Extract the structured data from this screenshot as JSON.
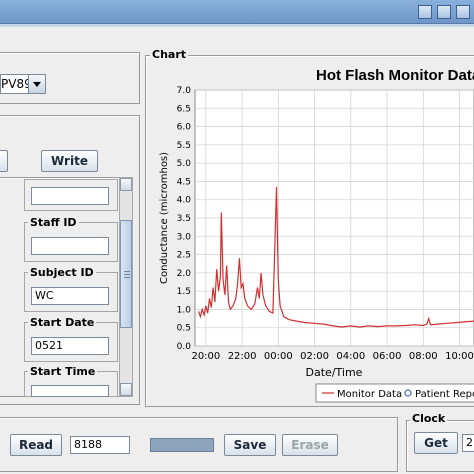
{
  "window": {},
  "chart_panel": {
    "title": "Chart"
  },
  "device": {
    "selected": "PV89"
  },
  "buttons": {
    "write": "Write",
    "read": "Read",
    "save": "Save",
    "erase": "Erase",
    "get": "Get"
  },
  "fields": {
    "staff_id": {
      "label": "Staff ID",
      "value": ""
    },
    "subject_id": {
      "label": "Subject ID",
      "value": "WC"
    },
    "start_date": {
      "label": "Start Date",
      "value": "0521"
    },
    "start_time": {
      "label": "Start Time",
      "value": ""
    },
    "top_field": {
      "value": ""
    }
  },
  "read_value": "8188",
  "clock": {
    "title": "Clock",
    "value": "2"
  },
  "colors": {
    "series": "#d03030",
    "legend_circle": "#4a6ab0",
    "accent": "#6e97c8"
  },
  "chart_data": {
    "type": "line",
    "title": "Hot Flash Monitor Data",
    "xlabel": "Date/Time",
    "ylabel": "Conductance (micromhos)",
    "x_tick_labels": [
      "20:00",
      "22:00",
      "00:00",
      "02:00",
      "04:00",
      "06:00",
      "08:00",
      "10:00"
    ],
    "x_range_hours": [
      19.4,
      34.8
    ],
    "y_ticks": [
      "0.0",
      "0.5",
      "1.0",
      "1.5",
      "2.0",
      "2.5",
      "3.0",
      "3.5",
      "4.0",
      "4.5",
      "5.0",
      "5.5",
      "6.0",
      "6.5",
      "7.0"
    ],
    "ylim": [
      0,
      7
    ],
    "grid": true,
    "legend_position": "bottom",
    "series": [
      {
        "name": "Monitor Data",
        "style": "line",
        "color": "#d03030",
        "points": [
          [
            19.6,
            0.95
          ],
          [
            19.7,
            0.8
          ],
          [
            19.8,
            1.0
          ],
          [
            19.9,
            0.85
          ],
          [
            20.0,
            1.1
          ],
          [
            20.1,
            0.9
          ],
          [
            20.2,
            1.3
          ],
          [
            20.3,
            1.05
          ],
          [
            20.4,
            1.6
          ],
          [
            20.5,
            1.2
          ],
          [
            20.6,
            2.1
          ],
          [
            20.7,
            1.5
          ],
          [
            20.8,
            1.9
          ],
          [
            20.85,
            3.65
          ],
          [
            20.95,
            1.8
          ],
          [
            21.05,
            1.4
          ],
          [
            21.15,
            2.2
          ],
          [
            21.25,
            1.2
          ],
          [
            21.35,
            1.0
          ],
          [
            21.5,
            1.1
          ],
          [
            21.65,
            1.3
          ],
          [
            21.75,
            1.7
          ],
          [
            21.85,
            2.4
          ],
          [
            21.95,
            1.6
          ],
          [
            22.05,
            1.7
          ],
          [
            22.15,
            1.3
          ],
          [
            22.3,
            1.1
          ],
          [
            22.5,
            1.0
          ],
          [
            22.7,
            1.15
          ],
          [
            22.85,
            1.6
          ],
          [
            22.95,
            1.3
          ],
          [
            23.05,
            2.0
          ],
          [
            23.15,
            1.4
          ],
          [
            23.3,
            1.1
          ],
          [
            23.5,
            0.95
          ],
          [
            23.7,
            0.9
          ],
          [
            23.8,
            2.6
          ],
          [
            23.9,
            4.35
          ],
          [
            24.0,
            1.8
          ],
          [
            24.1,
            1.1
          ],
          [
            24.3,
            0.8
          ],
          [
            24.6,
            0.72
          ],
          [
            25.0,
            0.68
          ],
          [
            25.5,
            0.64
          ],
          [
            26.0,
            0.62
          ],
          [
            26.5,
            0.6
          ],
          [
            27.0,
            0.55
          ],
          [
            27.5,
            0.52
          ],
          [
            28.0,
            0.55
          ],
          [
            28.5,
            0.52
          ],
          [
            29.0,
            0.55
          ],
          [
            29.5,
            0.53
          ],
          [
            30.0,
            0.55
          ],
          [
            30.5,
            0.55
          ],
          [
            31.0,
            0.56
          ],
          [
            31.5,
            0.58
          ],
          [
            32.0,
            0.56
          ],
          [
            32.2,
            0.6
          ],
          [
            32.3,
            0.75
          ],
          [
            32.4,
            0.58
          ],
          [
            32.8,
            0.6
          ],
          [
            33.3,
            0.62
          ],
          [
            33.8,
            0.64
          ],
          [
            34.3,
            0.66
          ],
          [
            34.8,
            0.68
          ]
        ]
      },
      {
        "name": "Patient Report",
        "style": "marker",
        "color": "#4a6ab0",
        "points": []
      }
    ]
  }
}
